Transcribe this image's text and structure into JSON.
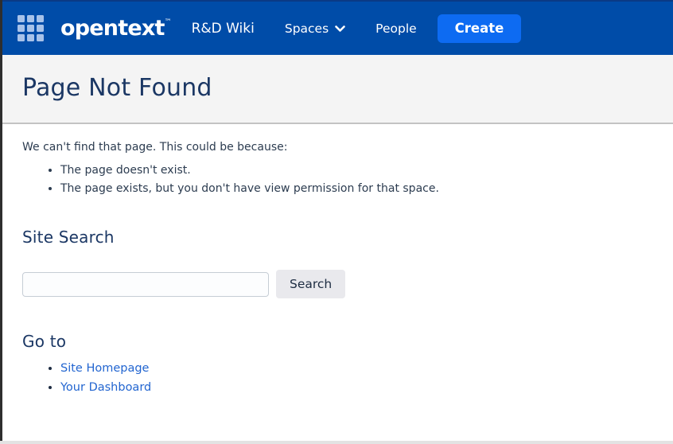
{
  "nav": {
    "logo_text": "opentext",
    "logo_tm": "™",
    "site_title": "R&D Wiki",
    "items": [
      {
        "label": "Spaces",
        "has_dropdown": true
      },
      {
        "label": "People",
        "has_dropdown": false
      }
    ],
    "create_label": "Create",
    "colors": {
      "bar": "#004CA8",
      "create_button": "#0d6bf2",
      "grid_icon": "#a7c2e9"
    }
  },
  "page": {
    "title": "Page Not Found",
    "intro": "We can't find that page. This could be because:",
    "reasons": [
      "The page doesn't exist.",
      "The page exists, but you don't have view permission for that space."
    ],
    "search": {
      "heading": "Site Search",
      "input_value": "",
      "input_placeholder": "",
      "button_label": "Search"
    },
    "goto": {
      "heading": "Go to",
      "links": [
        {
          "label": "Site Homepage"
        },
        {
          "label": "Your Dashboard"
        }
      ],
      "link_color": "#2265d0"
    }
  }
}
